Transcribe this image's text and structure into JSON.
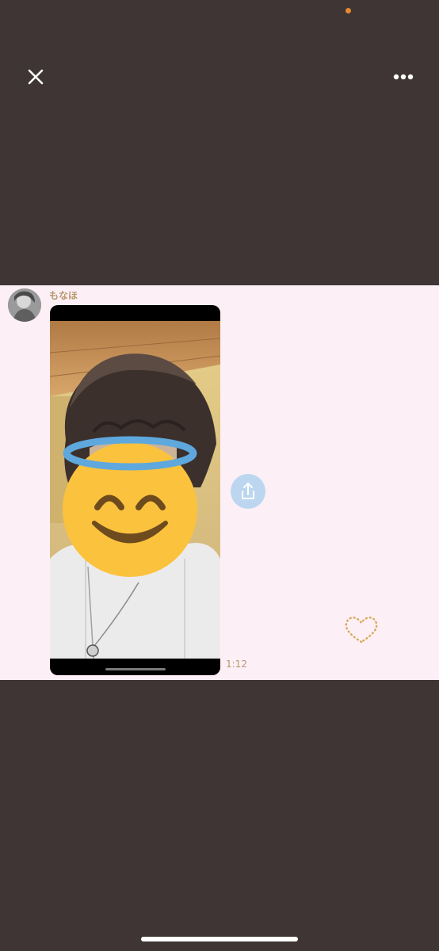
{
  "viewer": {
    "close_icon": "close-icon",
    "more_icon": "more-horizontal-icon",
    "status_dot_color": "#e8892e"
  },
  "chat": {
    "background_color": "#fcf0f6",
    "message": {
      "sender_name": "もなほ",
      "type": "video",
      "timestamp": "1:12",
      "share_icon": "share-icon"
    },
    "decoration_icon": "heart-outline-icon"
  },
  "colors": {
    "viewer_background": "#3f3535",
    "accent_text": "#b9956b",
    "share_button": "#bcd6ef"
  }
}
